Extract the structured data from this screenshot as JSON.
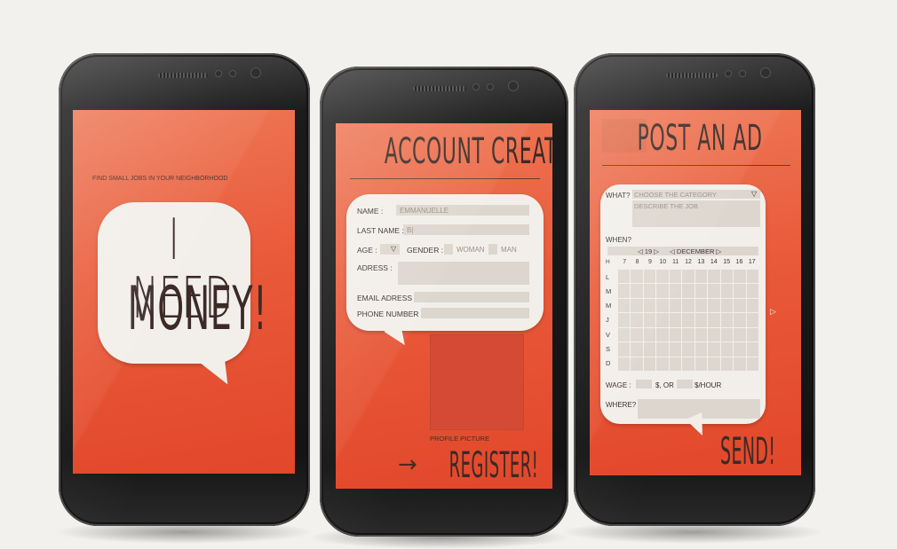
{
  "screen1": {
    "tagline": "FIND SMALL JOBS IN YOUR NEIGHBORHOOD",
    "headline_line1": "I NEED",
    "headline_line2": "MONEY!"
  },
  "screen2": {
    "title": "ACCOUNT CREATION",
    "name_label": "NAME :",
    "name_value": "EMMANUELLE",
    "lastname_label": "LAST NAME :",
    "lastname_value": "B|",
    "age_label": "AGE :",
    "age_arrow": "▽",
    "gender_label": "GENDER :",
    "woman_option": "WOMAN",
    "man_option": "MAN",
    "address_label": "ADRESS :",
    "email_label": "EMAIL ADRESS :",
    "phone_label": "PHONE NUMBER :",
    "profile_picture_label": "PROFILE PICTURE",
    "register_label": "REGISTER!",
    "arrow": "→"
  },
  "screen3": {
    "title": "POST AN AD",
    "what_label": "WHAT?",
    "category_placeholder": "CHOOSE THE CATEGORY",
    "category_arrow": "▽",
    "describe_placeholder": "DESCRIBE THE JOB",
    "when_label": "WHEN?",
    "day_selector": "◁ 19 ▷",
    "month_selector": "◁ DECEMBER ▷",
    "corner_label": "H",
    "hours": [
      "7",
      "8",
      "9",
      "10",
      "11",
      "12",
      "13",
      "14",
      "15",
      "16",
      "17"
    ],
    "days": [
      "L",
      "M",
      "M",
      "J",
      "V",
      "S",
      "D"
    ],
    "next_arrow": "▷",
    "wage_label": "WAGE :",
    "wage_or": "$, OR",
    "wage_hour": "$/HOUR",
    "where_label": "WHERE?",
    "send_label": "SEND!"
  },
  "colors": {
    "screen_orange": "#e95a3a",
    "bubble": "#f2efea",
    "field": "#dcd6ce"
  }
}
